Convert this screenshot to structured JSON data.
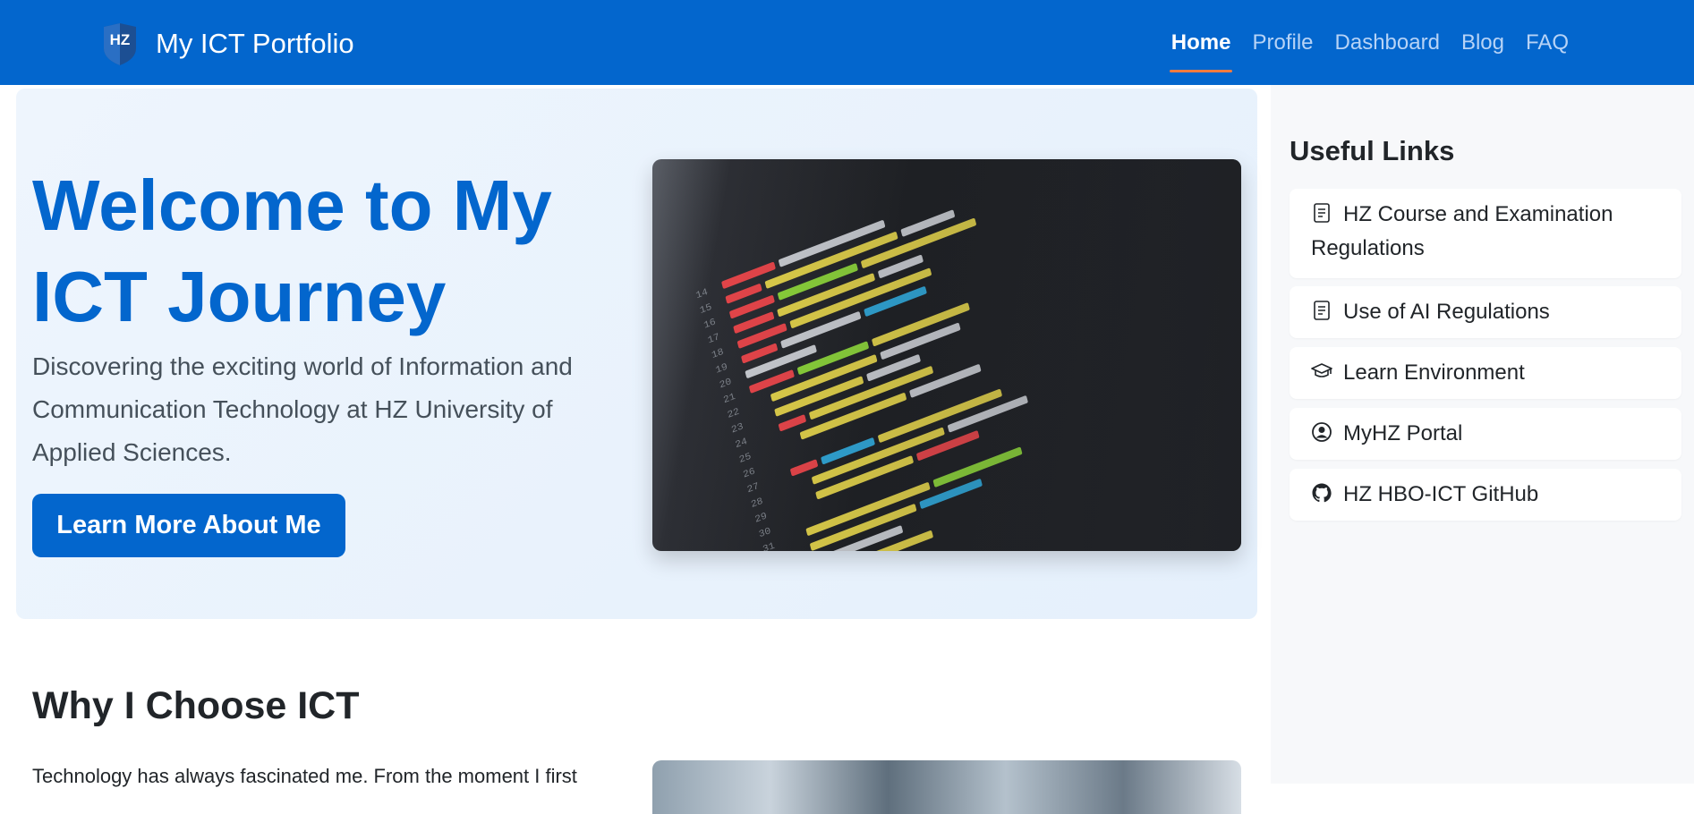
{
  "navbar": {
    "brand_logo_text": "HZ",
    "brand_title": "My ICT Portfolio",
    "links": [
      {
        "label": "Home",
        "active": true
      },
      {
        "label": "Profile",
        "active": false
      },
      {
        "label": "Dashboard",
        "active": false
      },
      {
        "label": "Blog",
        "active": false
      },
      {
        "label": "FAQ",
        "active": false
      }
    ]
  },
  "hero": {
    "title": "Welcome to My ICT Journey",
    "subtitle": "Discovering the exciting world of Information and Communication Technology at HZ University of Applied Sciences.",
    "button_label": "Learn More About Me"
  },
  "section": {
    "title": "Why I Choose ICT",
    "text": "Technology has always fascinated me. From the moment I first"
  },
  "sidebar": {
    "title": "Useful Links",
    "links": [
      {
        "label": "HZ Course and Examination Regulations",
        "icon": "document-icon"
      },
      {
        "label": "Use of AI Regulations",
        "icon": "document-icon"
      },
      {
        "label": "Learn Environment",
        "icon": "graduation-cap-icon"
      },
      {
        "label": "MyHZ Portal",
        "icon": "user-circle-icon"
      },
      {
        "label": "HZ HBO-ICT GitHub",
        "icon": "github-icon"
      }
    ]
  },
  "colors": {
    "primary": "#0366cd",
    "nav_active_underline": "#f07b3f",
    "hero_background": "#eef5fd",
    "sidebar_background": "#f7f8fa"
  }
}
